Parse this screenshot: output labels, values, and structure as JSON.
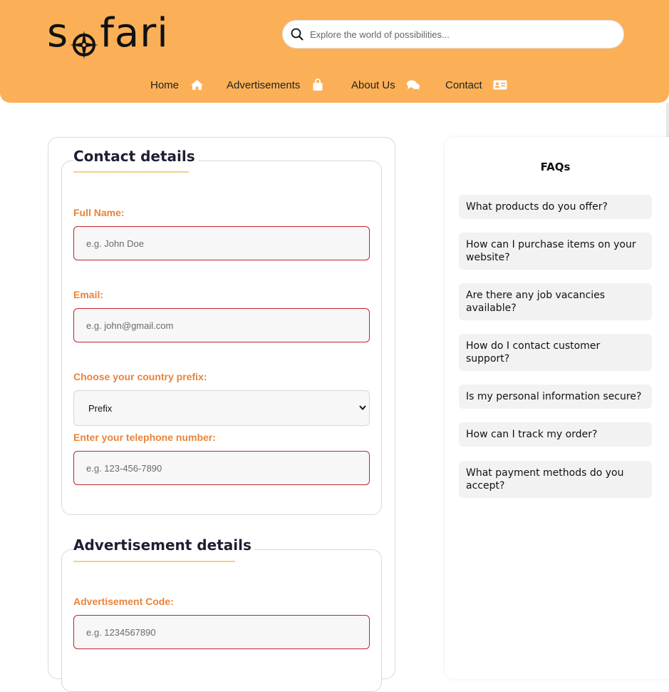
{
  "brand": {
    "logo_text_pre": "s",
    "logo_text_post": "fari",
    "logo_color": "#111111",
    "header_color": "#fbb058",
    "accent_label_color": "#e8843a",
    "input_border_color": "#c0272d"
  },
  "search": {
    "placeholder": "Explore the world of possibilities..."
  },
  "nav": {
    "items": [
      {
        "label": "Home",
        "icon": "home-icon"
      },
      {
        "label": "Advertisements",
        "icon": "shopping-bag-icon"
      },
      {
        "label": "About Us",
        "icon": "chat-bubbles-icon"
      },
      {
        "label": "Contact",
        "icon": "id-card-icon"
      }
    ]
  },
  "contact": {
    "legend": "Contact details",
    "full_name_label": "Full Name:",
    "full_name_placeholder": "e.g. John Doe",
    "email_label": "Email:",
    "email_placeholder": "e.g. john@gmail.com",
    "prefix_label": "Choose your country prefix:",
    "prefix_value": "Prefix",
    "phone_label": "Enter your telephone number:",
    "phone_placeholder": "e.g. 123-456-7890"
  },
  "advertisement": {
    "legend": "Advertisement details",
    "code_label": "Advertisement Code:",
    "code_placeholder": "e.g. 1234567890"
  },
  "faq": {
    "title": "FAQs",
    "items": [
      "What products do you offer?",
      "How can I purchase items on your website?",
      "Are there any job vacancies available?",
      "How do I contact customer support?",
      "Is my personal information secure?",
      "How can I track my order?",
      "What payment methods do you accept?"
    ]
  }
}
